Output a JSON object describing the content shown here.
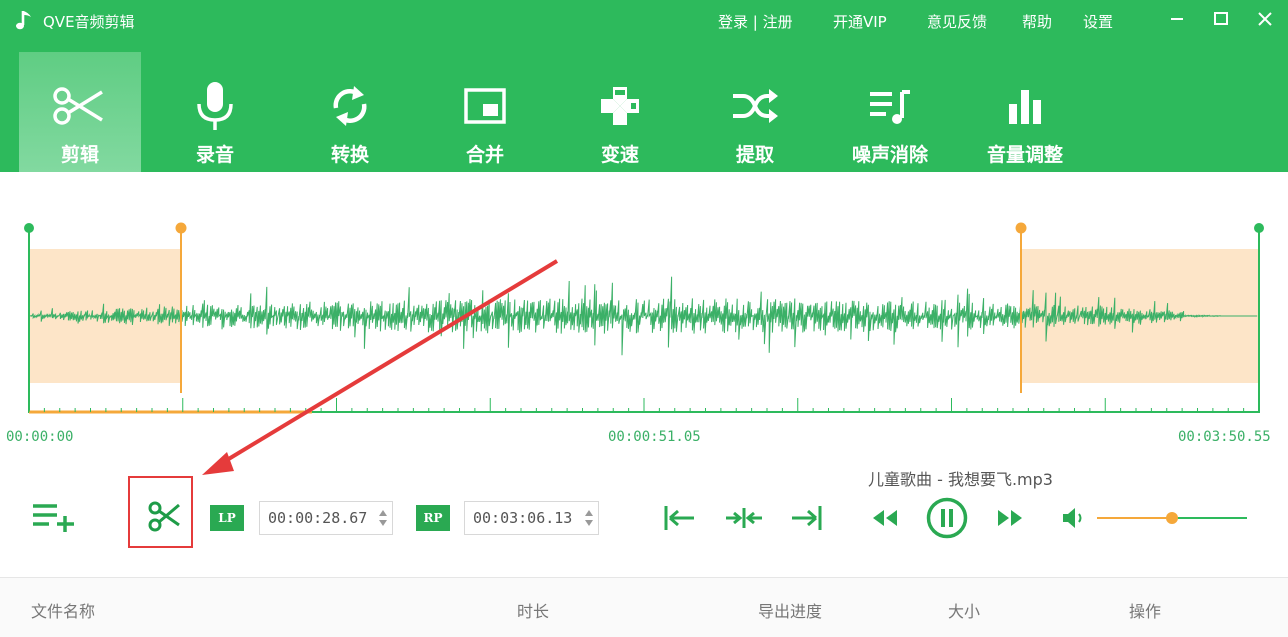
{
  "app": {
    "title": "QVE音频剪辑",
    "links": {
      "login_register": "登录 | 注册",
      "vip": "开通VIP",
      "feedback": "意见反馈",
      "help": "帮助",
      "settings": "设置"
    }
  },
  "toolbar": {
    "items": [
      {
        "label": "剪辑",
        "icon": "scissors-icon",
        "active": true
      },
      {
        "label": "录音",
        "icon": "microphone-icon"
      },
      {
        "label": "转换",
        "icon": "convert-icon"
      },
      {
        "label": "合并",
        "icon": "merge-icon"
      },
      {
        "label": "变速",
        "icon": "speed-icon"
      },
      {
        "label": "提取",
        "icon": "extract-icon"
      },
      {
        "label": "噪声消除",
        "icon": "noise-removal-icon"
      },
      {
        "label": "音量调整",
        "icon": "volume-adjust-icon"
      }
    ]
  },
  "waveform": {
    "start_time": "00:00:00",
    "mid_time": "00:00:51.05",
    "end_time": "00:03:50.55",
    "selection_start": "00:00:28.67",
    "selection_end": "00:03:06.13",
    "playhead_fraction": 0.23
  },
  "player": {
    "filename": "儿童歌曲 - 我想要飞.mp3",
    "lp_label": "LP",
    "rp_label": "RP",
    "lp_value": "00:00:28.67",
    "rp_value": "00:03:06.13",
    "volume_fraction": 0.5
  },
  "file_list": {
    "columns": [
      "文件名称",
      "时长",
      "导出进度",
      "大小",
      "操作"
    ]
  },
  "colors": {
    "brand": "#2dba5c",
    "selection_fill": "#fde5c8",
    "handle_orange": "#f5a83a",
    "annotation_red": "#e53b3b"
  }
}
